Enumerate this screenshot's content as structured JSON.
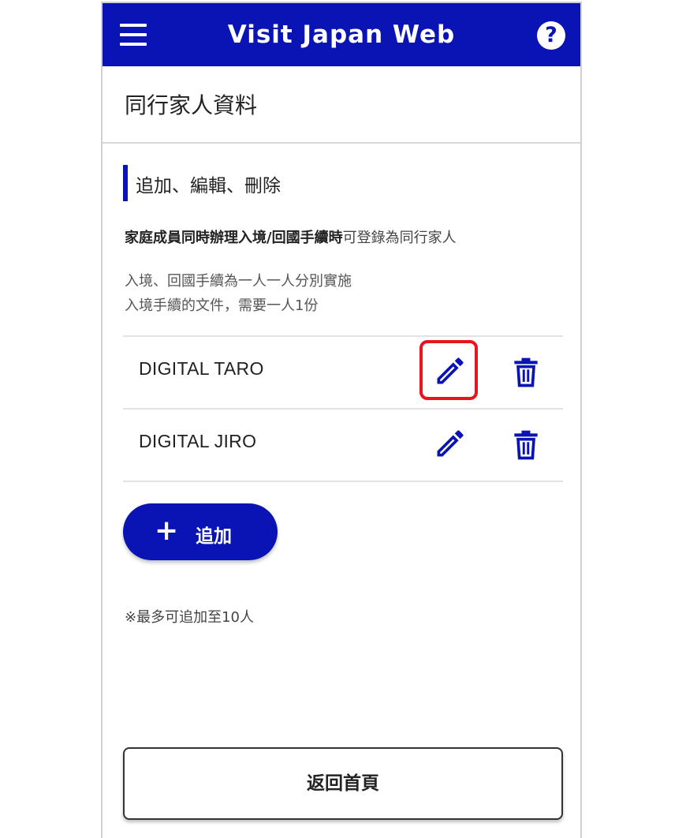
{
  "header": {
    "title": "Visit Japan Web",
    "menu_icon": "hamburger-menu-icon",
    "help_icon": "question-mark-icon",
    "help_symbol": "?"
  },
  "page": {
    "title": "同行家人資料"
  },
  "section": {
    "title": "追加、編輯、刪除"
  },
  "description": {
    "line1_bold": "家庭成員同時辦理入境/回國手續時",
    "line1_normal": "可登錄為同行家人",
    "line2": "入境、回國手續為一人一人分別實施",
    "line3": "入境手續的文件，需要一人1份"
  },
  "members": [
    {
      "name": "DIGITAL TARO",
      "highlighted_edit": true
    },
    {
      "name": "DIGITAL JIRO",
      "highlighted_edit": false
    }
  ],
  "actions": {
    "add_symbol": "+",
    "add_label": "追加",
    "max_note": "※最多可追加至10人",
    "home_label": "返回首頁"
  },
  "colors": {
    "brand_blue": "#0a14b4",
    "highlight_red": "#e8141e",
    "text_dark": "#222222",
    "divider": "#e2e2e2"
  }
}
